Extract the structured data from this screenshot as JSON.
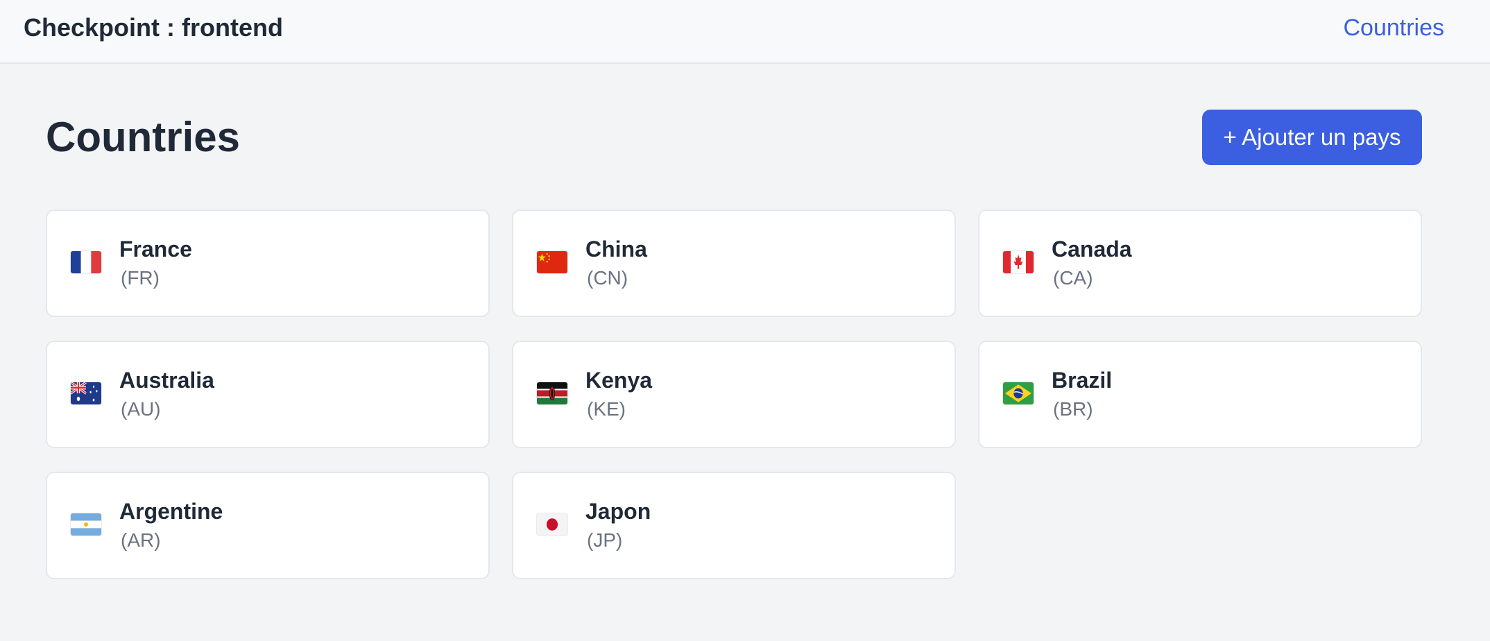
{
  "navbar": {
    "brand": "Checkpoint : frontend",
    "link_label": "Countries"
  },
  "page": {
    "title": "Countries",
    "add_button_label": "+ Ajouter un pays"
  },
  "countries": [
    {
      "name": "France",
      "code": "(FR)",
      "flag_icon": "flag-fr-icon"
    },
    {
      "name": "China",
      "code": "(CN)",
      "flag_icon": "flag-cn-icon"
    },
    {
      "name": "Canada",
      "code": "(CA)",
      "flag_icon": "flag-ca-icon"
    },
    {
      "name": "Australia",
      "code": "(AU)",
      "flag_icon": "flag-au-icon"
    },
    {
      "name": "Kenya",
      "code": "(KE)",
      "flag_icon": "flag-ke-icon"
    },
    {
      "name": "Brazil",
      "code": "(BR)",
      "flag_icon": "flag-br-icon"
    },
    {
      "name": "Argentine",
      "code": "(AR)",
      "flag_icon": "flag-ar-icon"
    },
    {
      "name": "Japon",
      "code": "(JP)",
      "flag_icon": "flag-jp-icon"
    }
  ],
  "colors": {
    "accent": "#3b5fe0",
    "background": "#f3f4f6",
    "card": "#ffffff",
    "text": "#1f2937",
    "muted": "#6b7280"
  }
}
